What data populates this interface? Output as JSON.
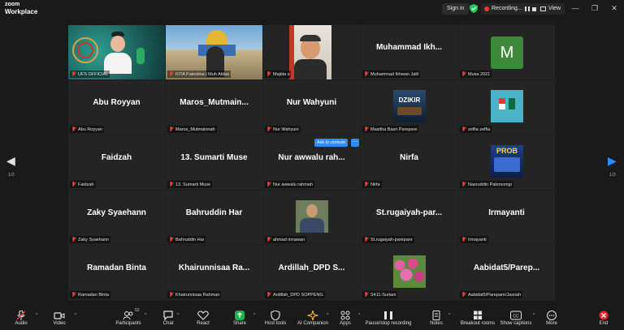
{
  "app": {
    "logo_top": "zoom",
    "logo_bottom": "Workplace"
  },
  "titlebar": {
    "signin": "Sign in",
    "recording": "Recording...",
    "view": "View",
    "minimize": "—",
    "maximize": "❐",
    "close": "✕"
  },
  "gallery": {
    "page_indicator_left": "1/3",
    "page_indicator_right": "1/3",
    "ask_to_unmute": "Ask to unmute",
    "more": "···",
    "tiles": [
      {
        "center": "",
        "label": "UFS OFFICIAL",
        "video": "ufs"
      },
      {
        "center": "",
        "label": "KITA Palestina | Muh Akbar",
        "video": "mosque"
      },
      {
        "center": "",
        "label": "Majida s",
        "video": "majida"
      },
      {
        "center": "Muhammad  Ikh...",
        "label": "Muhammad Ikhwan Jalil",
        "video": ""
      },
      {
        "center": "",
        "label": "Musa 2021",
        "video": "avatar-m"
      },
      {
        "center": "Abu Royyan",
        "label": "Abu Royyan",
        "video": ""
      },
      {
        "center": "Maros_Mutmain...",
        "label": "Maros_Mutmainnah",
        "video": ""
      },
      {
        "center": "Nur Wahyuni",
        "label": "Nur Wahyuni",
        "video": ""
      },
      {
        "center": "",
        "label": "Masitha Basri Parepare",
        "video": "dzikir"
      },
      {
        "center": "",
        "label": "zelfia zelfia",
        "video": "flag"
      },
      {
        "center": "Faidzah",
        "label": "Faidzah",
        "video": ""
      },
      {
        "center": "13. Sumarti Muse",
        "label": "13. Sumarti Muse",
        "video": ""
      },
      {
        "center": "Nur awwalu rah...",
        "label": "Nur awwalu rahmah",
        "video": ""
      },
      {
        "center": "Nirfa",
        "label": "Nirfa",
        "video": ""
      },
      {
        "center": "",
        "label": "Nasruddin Paloncengi",
        "video": "prob"
      },
      {
        "center": "Zaky Syaehann",
        "label": "Zaky Syaehann",
        "video": ""
      },
      {
        "center": "Bahruddin Har",
        "label": "Bahruddin Har",
        "video": ""
      },
      {
        "center": "",
        "label": "ahmad rimawan",
        "video": "ahmad"
      },
      {
        "center": "St.rugaiyah-par...",
        "label": "St.rugaiyah-parepare",
        "video": ""
      },
      {
        "center": "Irmayanti",
        "label": "Irmayanti",
        "video": ""
      },
      {
        "center": "Ramadan Binta",
        "label": "Ramadan Binta",
        "video": ""
      },
      {
        "center": "Khairunnisaa  Ra...",
        "label": "Khairunnisaa Rahman",
        "video": ""
      },
      {
        "center": "Ardillah_DPD  S...",
        "label": "Ardillah_DPD SOPPENG",
        "video": ""
      },
      {
        "center": "",
        "label": "S411-Suriani",
        "video": "flowers"
      },
      {
        "center": "Aabidat5/Parep...",
        "label": "Aabidat5/Parepare/Jasnah",
        "video": ""
      }
    ],
    "avatar_letter": "M",
    "dzikir_text": "DZIKIR",
    "prob_text": "PROB"
  },
  "toolbar": {
    "participants_count": "52",
    "items": [
      {
        "label": "Audio",
        "icon": "mic-muted-icon"
      },
      {
        "label": "Video",
        "icon": "video-icon"
      },
      {
        "label": "Participants",
        "icon": "participants-icon"
      },
      {
        "label": "Chat",
        "icon": "chat-icon"
      },
      {
        "label": "React",
        "icon": "heart-icon"
      },
      {
        "label": "Share",
        "icon": "share-icon"
      },
      {
        "label": "Host tools",
        "icon": "shield-icon"
      },
      {
        "label": "AI Companion",
        "icon": "sparkle-icon"
      },
      {
        "label": "Apps",
        "icon": "apps-icon"
      },
      {
        "label": "Pause/stop recording",
        "icon": "record-icon"
      },
      {
        "label": "Notes",
        "icon": "notes-icon"
      },
      {
        "label": "Breakout rooms",
        "icon": "grid-icon"
      },
      {
        "label": "Show captions",
        "icon": "cc-icon"
      },
      {
        "label": "More",
        "icon": "more-icon"
      },
      {
        "label": "End",
        "icon": "end-icon"
      }
    ]
  },
  "colors": {
    "accent": "#2d8cff",
    "active_speaker": "#27c45a",
    "mute": "#e53935",
    "share": "#19b24b",
    "end": "#e02828"
  }
}
